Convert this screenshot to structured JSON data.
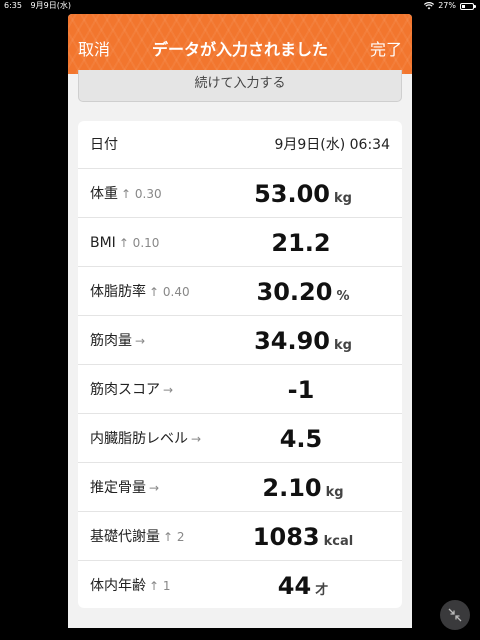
{
  "status_bar": {
    "time": "6:35",
    "date": "9月9日(水)",
    "battery": "27%"
  },
  "header": {
    "cancel_label": "取消",
    "title": "データが入力されました",
    "done_label": "完了"
  },
  "continue_label": "続けて入力する",
  "date_row": {
    "label": "日付",
    "value": "9月9日(水) 06:34"
  },
  "rows": [
    {
      "label": "体重",
      "change": "↑ 0.30",
      "value": "53.00",
      "unit": "kg"
    },
    {
      "label": "BMI",
      "change": "↑ 0.10",
      "value": "21.2",
      "unit": ""
    },
    {
      "label": "体脂肪率",
      "change": "↑ 0.40",
      "value": "30.20",
      "unit": "%"
    },
    {
      "label": "筋肉量",
      "change": "→",
      "value": "34.90",
      "unit": "kg"
    },
    {
      "label": "筋肉スコア",
      "change": "→",
      "value": "-1",
      "unit": ""
    },
    {
      "label": "内臓脂肪レベル",
      "change": "→",
      "value": "4.5",
      "unit": ""
    },
    {
      "label": "推定骨量",
      "change": "→",
      "value": "2.10",
      "unit": "kg"
    },
    {
      "label": "基礎代謝量",
      "change": "↑ 2",
      "value": "1083",
      "unit": "kcal"
    },
    {
      "label": "体内年齢",
      "change": "↑ 1",
      "value": "44",
      "unit": "才"
    }
  ]
}
